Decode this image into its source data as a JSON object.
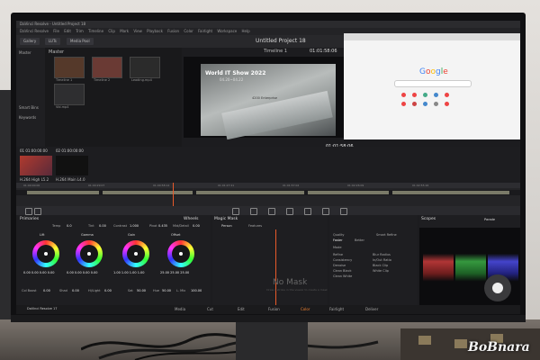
{
  "app": {
    "window_title": "DaVinci Resolve - Untitled Project 18",
    "menu": [
      "DaVinci Resolve",
      "File",
      "Edit",
      "Trim",
      "Timeline",
      "Clip",
      "Mark",
      "View",
      "Playback",
      "Fusion",
      "Color",
      "Fairlight",
      "Workspace",
      "Help"
    ],
    "toolbar_buttons": [
      "Gallery",
      "LUTs",
      "Media Pool"
    ],
    "project_title": "Untitled Project 18",
    "timeline_name": "Timeline 1",
    "timecode_top": "01:01:58:06",
    "timecode_main": "01:01:58:06"
  },
  "media_pool": {
    "bin_label": "Master",
    "smart_bins": "Smart Bins",
    "keywords": "Keywords",
    "clips": [
      {
        "label": "Timeline 1"
      },
      {
        "label": "Timeline 2"
      },
      {
        "label": "Leading.mp4"
      },
      {
        "label": "Vid.mp4"
      }
    ]
  },
  "viewer": {
    "overlay_title": "World IT Show 2022",
    "overlay_date": "04.20~04.22",
    "device_text": "4200 Enterprise"
  },
  "browser": {
    "logo": "Google",
    "logo_colors": [
      "#4285F4",
      "#EA4335",
      "#FBBC05",
      "#4285F4",
      "#34A853",
      "#EA4335"
    ]
  },
  "clip_strip": {
    "clips": [
      {
        "tc": "01  01:00:00:00",
        "name": "H.264 High L5.2"
      },
      {
        "tc": "02  01:00:00:00",
        "name": "H.264 Main L4.0"
      }
    ]
  },
  "timeline_ruler": [
    "01:00:00:00",
    "01:00:29:07",
    "01:00:58:14",
    "01:01:27:21",
    "01:01:57:02",
    "01:02:26:09",
    "01:02:55:16"
  ],
  "color_page": {
    "primaries_label": "Primaries",
    "wheels_label": "Wheels",
    "temp_label": "Temp",
    "temp_value": "0.0",
    "tint_label": "Tint",
    "tint_value": "0.00",
    "contrast_label": "Contrast",
    "contrast_value": "1.000",
    "pivot_label": "Pivot",
    "pivot_value": "0.435",
    "middetail_label": "Mid/Detail",
    "middetail_value": "0.00",
    "wheels": [
      {
        "name": "Lift",
        "values": "0.00  0.00  0.00  0.00"
      },
      {
        "name": "Gamma",
        "values": "0.00  0.00  0.00  0.00"
      },
      {
        "name": "Gain",
        "values": "1.00  1.00  1.00  1.00"
      },
      {
        "name": "Offset",
        "values": "25.00  25.00  25.00"
      }
    ],
    "bottom_params": [
      {
        "label": "Col Boost",
        "value": "0.00"
      },
      {
        "label": "Shad",
        "value": "0.00"
      },
      {
        "label": "Hi/Light",
        "value": "0.00"
      },
      {
        "label": "Sat",
        "value": "50.00"
      },
      {
        "label": "Hue",
        "value": "50.00"
      },
      {
        "label": "L. Mix",
        "value": "100.00"
      }
    ],
    "magic_mask_label": "Magic Mask",
    "person_label": "Person",
    "features_label": "Features",
    "no_mask": "No Mask",
    "no_mask_hint": "Draw a stroke in the viewer to create a mask",
    "quality_label": "Quality",
    "faster": "Faster",
    "better": "Better",
    "mode": "Mode",
    "smart_refine": "Smart Refine",
    "mask_params": [
      "Refine",
      "Consistency",
      "Denoise",
      "Clean Black",
      "Clean White",
      "Blur Radius",
      "In/Out Ratio",
      "Black Clip",
      "White Clip"
    ],
    "scopes_label": "Scopes",
    "parade_label": "Parade"
  },
  "pages": [
    "Media",
    "Cut",
    "Edit",
    "Fusion",
    "Color",
    "Fairlight",
    "Deliver"
  ],
  "active_page": "Color",
  "product_label": "DaVinci Resolve 17",
  "watermark": "BoBnara"
}
